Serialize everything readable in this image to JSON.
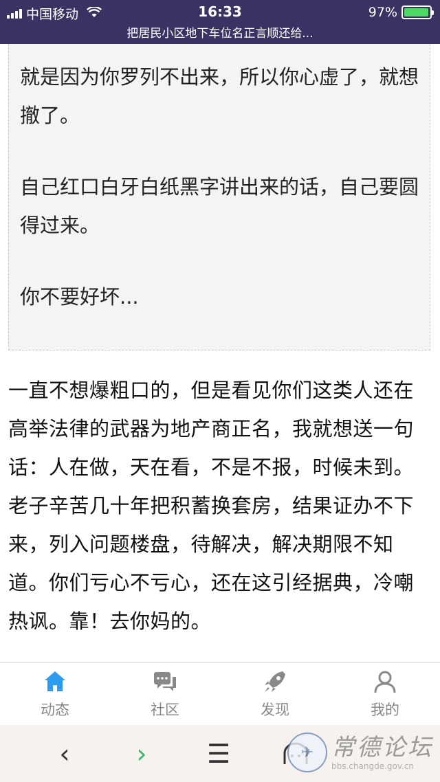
{
  "status": {
    "carrier": "中国移动",
    "time": "16:33",
    "battery": "97%",
    "battery_level": 0.97
  },
  "page": {
    "title": "把居民小区地下车位名正言顺还给..."
  },
  "quote": {
    "p1": "就是因为你罗列不出来，所以你心虚了，就想撤了。",
    "p2": "自己红口白牙白纸黑字讲出来的话，自己要圆得过来。",
    "p3": "你不要好坏..."
  },
  "reply": {
    "text": "一直不想爆粗口的，但是看见你们这类人还在高举法律的武器为地产商正名，我就想送一句话：人在做，天在看，不是不报，时候未到。老子辛苦几十年把积蓄换套房，结果证办不下来，列入问题楼盘，待解决，解决期限不知道。你们亏心不亏心，还在这引经据典，冷嘲热讽。靠！去你妈的。"
  },
  "tabs": [
    {
      "label": "动态",
      "icon": "home-icon",
      "active": true
    },
    {
      "label": "社区",
      "icon": "chat-icon",
      "active": false
    },
    {
      "label": "发现",
      "icon": "rocket-icon",
      "active": false
    },
    {
      "label": "我的",
      "icon": "user-icon",
      "active": false
    }
  ],
  "browser": {
    "back": "‹",
    "forward": "›",
    "menu": "☰"
  },
  "watermark": {
    "title": "常德论坛",
    "url": "bbs.changde.gov.cn"
  },
  "colors": {
    "header_bg": "#3a3262",
    "active_tab": "#2b9cf2",
    "inactive_tab": "#888888",
    "battery_fill": "#4cd964"
  }
}
